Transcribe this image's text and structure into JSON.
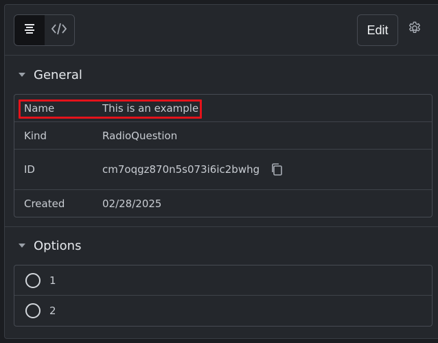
{
  "toolbar": {
    "edit_label": "Edit",
    "icons": [
      "text-align-icon",
      "code-icon",
      "gear-icon"
    ]
  },
  "general": {
    "title": "General",
    "rows": [
      {
        "label": "Name",
        "value": "This is an example"
      },
      {
        "label": "Kind",
        "value": "RadioQuestion"
      },
      {
        "label": "ID",
        "value": "cm7oqgz870n5s073i6ic2bwhg"
      },
      {
        "label": "Created",
        "value": "02/28/2025"
      }
    ]
  },
  "options": {
    "title": "Options",
    "items": [
      {
        "label": "1"
      },
      {
        "label": "2"
      }
    ]
  },
  "colors": {
    "highlight": "#e5131b",
    "background": "#24272c"
  }
}
